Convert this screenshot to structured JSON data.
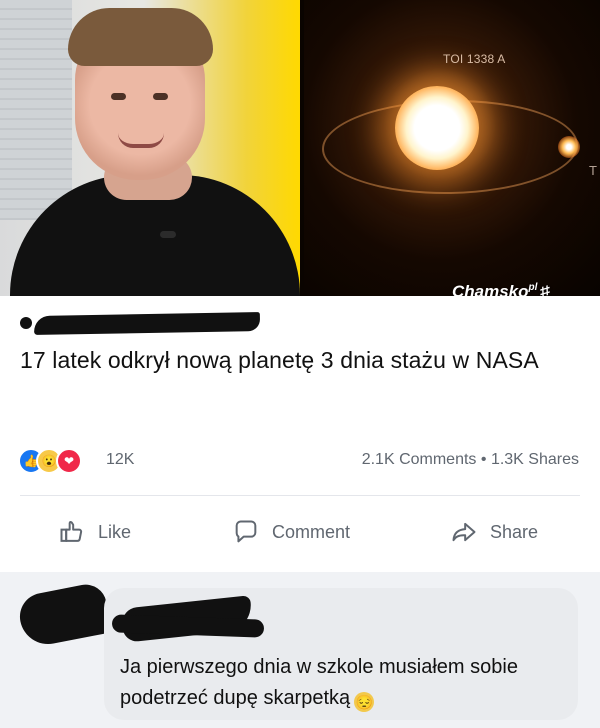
{
  "image": {
    "planet_label": "TOI 1338 A",
    "side_letter": "T",
    "watermark": "Chamsko",
    "watermark_suffix": "pl",
    "watermark_icon": "hashtag-icon"
  },
  "post": {
    "headline": "17 latek odkrył nową planetę 3 dnia stażu w NASA",
    "reaction_icons": [
      "like-icon",
      "wow-icon",
      "love-icon"
    ],
    "reaction_count": "12K",
    "comments_count": "2.1K Comments",
    "shares_count": "1.3K Shares",
    "separator": "•",
    "actions": {
      "like": "Like",
      "comment": "Comment",
      "share": "Share"
    }
  },
  "comment": {
    "text": "Ja pierwszego dnia w szkole musiałem sobie podetrzeć dupę skarpetką",
    "emoji": "😔"
  },
  "colors": {
    "accent": "#1877f2",
    "surface": "#ffffff",
    "background": "#f0f2f5",
    "text": "#111111",
    "muted": "#606770"
  }
}
